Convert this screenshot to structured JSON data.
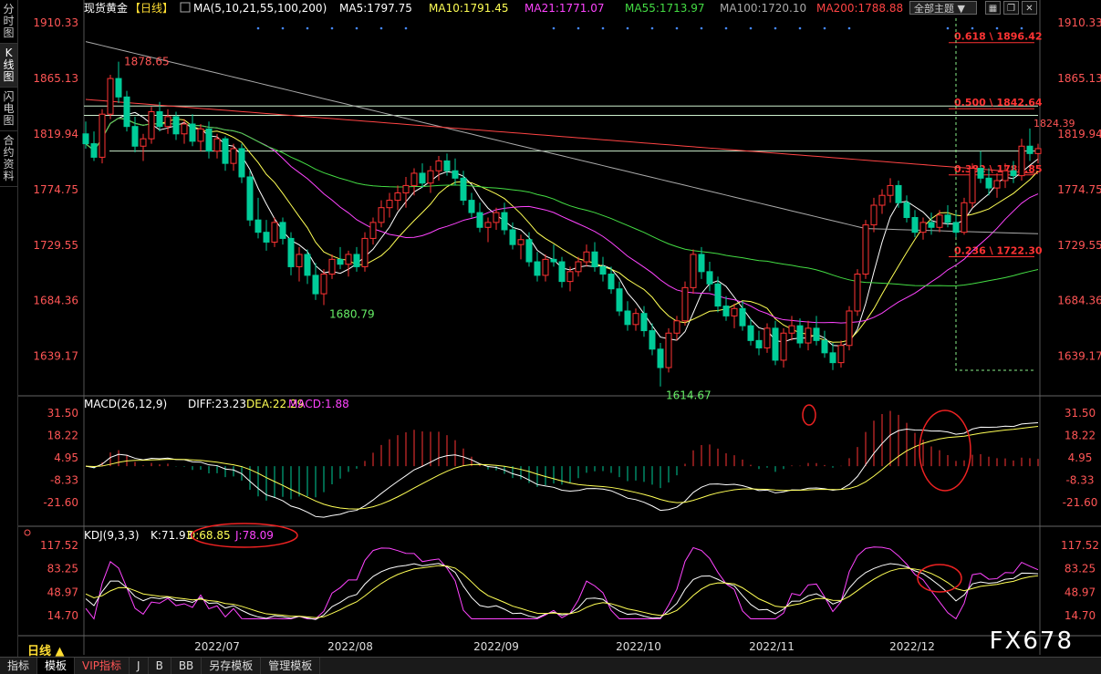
{
  "sidebar": {
    "tabs": [
      {
        "label": "分时图",
        "active": false
      },
      {
        "label": "K线图",
        "active": true
      },
      {
        "label": "闪电图",
        "active": false
      },
      {
        "label": "合约资料",
        "active": false
      }
    ]
  },
  "header": {
    "symbol": "现货黄金",
    "period_tag": "【日线】",
    "ma_title": "MA(5,10,21,55,100,200)",
    "ma_values": [
      {
        "label": "MA5:1797.75",
        "color": "#ffffff"
      },
      {
        "label": "MA10:1791.45",
        "color": "#ffff55"
      },
      {
        "label": "MA21:1771.07",
        "color": "#ff44ff"
      },
      {
        "label": "MA55:1713.97",
        "color": "#44dd44"
      },
      {
        "label": "MA100:1720.10",
        "color": "#aaaaaa"
      },
      {
        "label": "MA200:1788.88",
        "color": "#ff4444"
      }
    ],
    "theme_select": "全部主题",
    "theme_icon": "chevron-down-icon"
  },
  "price_axis": [
    "1910.33",
    "1865.13",
    "1819.94",
    "1774.75",
    "1729.55",
    "1684.36",
    "1639.17"
  ],
  "annotations": {
    "high_left": "1878.65",
    "low_mid": "1680.79",
    "low_bottom": "1614.67",
    "recent_high": "1824.39",
    "fib_618": "0.618 \\ 1896.42",
    "fib_500": "0.500 \\ 1842.64",
    "fib_382": "0.382 \\ 1788.85",
    "fib_236": "0.236 \\ 1722.30"
  },
  "macd": {
    "title": "MACD(26,12,9)",
    "diff": "DIFF:23.23",
    "dea": "DEA:22.29",
    "macd": "MACD:1.88",
    "axis": [
      "31.50",
      "18.22",
      "4.95",
      "-8.33",
      "-21.60"
    ]
  },
  "kdj": {
    "title": "KDJ(9,3,3)",
    "k": "K:71.93",
    "d": "D:68.85",
    "j": "J:78.09",
    "axis": [
      "117.52",
      "83.25",
      "48.97",
      "14.70"
    ]
  },
  "x_axis": [
    "2022/07",
    "2022/08",
    "2022/09",
    "2022/10",
    "2022/11",
    "2022/12"
  ],
  "period_label": "日线",
  "toolbar": [
    "指标",
    "模板",
    "VIP指标",
    "J",
    "B",
    "BB",
    "另存模板",
    "管理模板"
  ],
  "watermark": "FX678",
  "colors": {
    "up": "#ff3333",
    "down": "#00cc99",
    "axis_red": "#ff4444",
    "fib": "#ff3333"
  },
  "chart_data": {
    "type": "candlestick",
    "title": "现货黄金 日线",
    "ohlc": [
      [
        1820,
        1830,
        1808,
        1812
      ],
      [
        1812,
        1822,
        1798,
        1801
      ],
      [
        1801,
        1840,
        1796,
        1836
      ],
      [
        1836,
        1868,
        1832,
        1865
      ],
      [
        1865,
        1878.65,
        1845,
        1850
      ],
      [
        1850,
        1855,
        1822,
        1826
      ],
      [
        1826,
        1834,
        1805,
        1810
      ],
      [
        1810,
        1820,
        1798,
        1816
      ],
      [
        1816,
        1842,
        1812,
        1838
      ],
      [
        1838,
        1846,
        1822,
        1826
      ],
      [
        1826,
        1840,
        1820,
        1834
      ],
      [
        1834,
        1838,
        1815,
        1820
      ],
      [
        1820,
        1832,
        1812,
        1828
      ],
      [
        1828,
        1836,
        1810,
        1814
      ],
      [
        1814,
        1828,
        1806,
        1824
      ],
      [
        1824,
        1830,
        1800,
        1806
      ],
      [
        1806,
        1820,
        1800,
        1816
      ],
      [
        1816,
        1818,
        1790,
        1796
      ],
      [
        1796,
        1812,
        1790,
        1808
      ],
      [
        1808,
        1812,
        1780,
        1785
      ],
      [
        1785,
        1790,
        1745,
        1750
      ],
      [
        1750,
        1768,
        1735,
        1740
      ],
      [
        1740,
        1750,
        1725,
        1732
      ],
      [
        1732,
        1752,
        1728,
        1748
      ],
      [
        1748,
        1752,
        1730,
        1735
      ],
      [
        1735,
        1740,
        1705,
        1712
      ],
      [
        1712,
        1728,
        1700,
        1722
      ],
      [
        1722,
        1726,
        1698,
        1705
      ],
      [
        1705,
        1715,
        1685,
        1690
      ],
      [
        1690,
        1710,
        1680.79,
        1706
      ],
      [
        1706,
        1722,
        1702,
        1718
      ],
      [
        1718,
        1728,
        1710,
        1714
      ],
      [
        1714,
        1725,
        1704,
        1722
      ],
      [
        1722,
        1728,
        1708,
        1712
      ],
      [
        1712,
        1740,
        1708,
        1735
      ],
      [
        1735,
        1752,
        1730,
        1748
      ],
      [
        1748,
        1766,
        1744,
        1760
      ],
      [
        1760,
        1772,
        1752,
        1766
      ],
      [
        1766,
        1778,
        1758,
        1772
      ],
      [
        1772,
        1785,
        1760,
        1778
      ],
      [
        1778,
        1792,
        1770,
        1788
      ],
      [
        1788,
        1796,
        1776,
        1780
      ],
      [
        1780,
        1794,
        1772,
        1790
      ],
      [
        1790,
        1802,
        1782,
        1798
      ],
      [
        1798,
        1804,
        1786,
        1790
      ],
      [
        1790,
        1800,
        1778,
        1784
      ],
      [
        1784,
        1790,
        1762,
        1766
      ],
      [
        1766,
        1772,
        1752,
        1756
      ],
      [
        1756,
        1764,
        1740,
        1744
      ],
      [
        1744,
        1752,
        1732,
        1748
      ],
      [
        1748,
        1760,
        1742,
        1756
      ],
      [
        1756,
        1764,
        1738,
        1742
      ],
      [
        1742,
        1748,
        1726,
        1730
      ],
      [
        1730,
        1738,
        1718,
        1734
      ],
      [
        1734,
        1740,
        1712,
        1716
      ],
      [
        1716,
        1724,
        1700,
        1705
      ],
      [
        1705,
        1722,
        1700,
        1718
      ],
      [
        1718,
        1730,
        1712,
        1716
      ],
      [
        1716,
        1720,
        1695,
        1700
      ],
      [
        1700,
        1712,
        1692,
        1708
      ],
      [
        1708,
        1720,
        1704,
        1716
      ],
      [
        1716,
        1730,
        1712,
        1724
      ],
      [
        1724,
        1732,
        1708,
        1712
      ],
      [
        1712,
        1720,
        1700,
        1706
      ],
      [
        1706,
        1712,
        1690,
        1694
      ],
      [
        1694,
        1700,
        1672,
        1676
      ],
      [
        1676,
        1684,
        1660,
        1665
      ],
      [
        1665,
        1678,
        1660,
        1674
      ],
      [
        1674,
        1680,
        1655,
        1660
      ],
      [
        1660,
        1666,
        1640,
        1645
      ],
      [
        1645,
        1650,
        1614.67,
        1630
      ],
      [
        1630,
        1662,
        1626,
        1658
      ],
      [
        1658,
        1672,
        1652,
        1668
      ],
      [
        1668,
        1700,
        1664,
        1695
      ],
      [
        1695,
        1726,
        1690,
        1722
      ],
      [
        1722,
        1728,
        1702,
        1708
      ],
      [
        1708,
        1716,
        1692,
        1698
      ],
      [
        1698,
        1704,
        1675,
        1680
      ],
      [
        1680,
        1688,
        1668,
        1672
      ],
      [
        1672,
        1682,
        1662,
        1678
      ],
      [
        1678,
        1684,
        1660,
        1664
      ],
      [
        1664,
        1670,
        1648,
        1652
      ],
      [
        1652,
        1660,
        1640,
        1646
      ],
      [
        1646,
        1666,
        1642,
        1662
      ],
      [
        1662,
        1668,
        1632,
        1636
      ],
      [
        1636,
        1662,
        1630,
        1658
      ],
      [
        1658,
        1672,
        1652,
        1664
      ],
      [
        1664,
        1670,
        1646,
        1650
      ],
      [
        1650,
        1668,
        1644,
        1662
      ],
      [
        1662,
        1672,
        1648,
        1652
      ],
      [
        1652,
        1660,
        1638,
        1642
      ],
      [
        1642,
        1650,
        1628,
        1634
      ],
      [
        1634,
        1652,
        1630,
        1648
      ],
      [
        1648,
        1680,
        1644,
        1676
      ],
      [
        1676,
        1710,
        1672,
        1706
      ],
      [
        1706,
        1750,
        1702,
        1746
      ],
      [
        1746,
        1768,
        1740,
        1762
      ],
      [
        1762,
        1775,
        1755,
        1770
      ],
      [
        1770,
        1784,
        1764,
        1778
      ],
      [
        1778,
        1782,
        1760,
        1764
      ],
      [
        1764,
        1770,
        1748,
        1752
      ],
      [
        1752,
        1758,
        1736,
        1740
      ],
      [
        1740,
        1752,
        1734,
        1748
      ],
      [
        1748,
        1756,
        1738,
        1744
      ],
      [
        1744,
        1758,
        1740,
        1754
      ],
      [
        1754,
        1762,
        1744,
        1748
      ],
      [
        1748,
        1756,
        1736,
        1740
      ],
      [
        1740,
        1768,
        1738,
        1764
      ],
      [
        1764,
        1796,
        1760,
        1792
      ],
      [
        1792,
        1806,
        1780,
        1784
      ],
      [
        1784,
        1792,
        1770,
        1776
      ],
      [
        1776,
        1788,
        1768,
        1782
      ],
      [
        1782,
        1796,
        1776,
        1790
      ],
      [
        1790,
        1798,
        1780,
        1786
      ],
      [
        1786,
        1816,
        1782,
        1810
      ],
      [
        1810,
        1824.39,
        1798,
        1804
      ],
      [
        1804,
        1812,
        1796,
        1808
      ]
    ],
    "fibonacci": [
      {
        "level": 0.618,
        "price": 1896.42
      },
      {
        "level": 0.5,
        "price": 1842.64
      },
      {
        "level": 0.382,
        "price": 1788.85
      },
      {
        "level": 0.236,
        "price": 1722.3
      }
    ],
    "ylim": [
      1610,
      1914
    ]
  }
}
